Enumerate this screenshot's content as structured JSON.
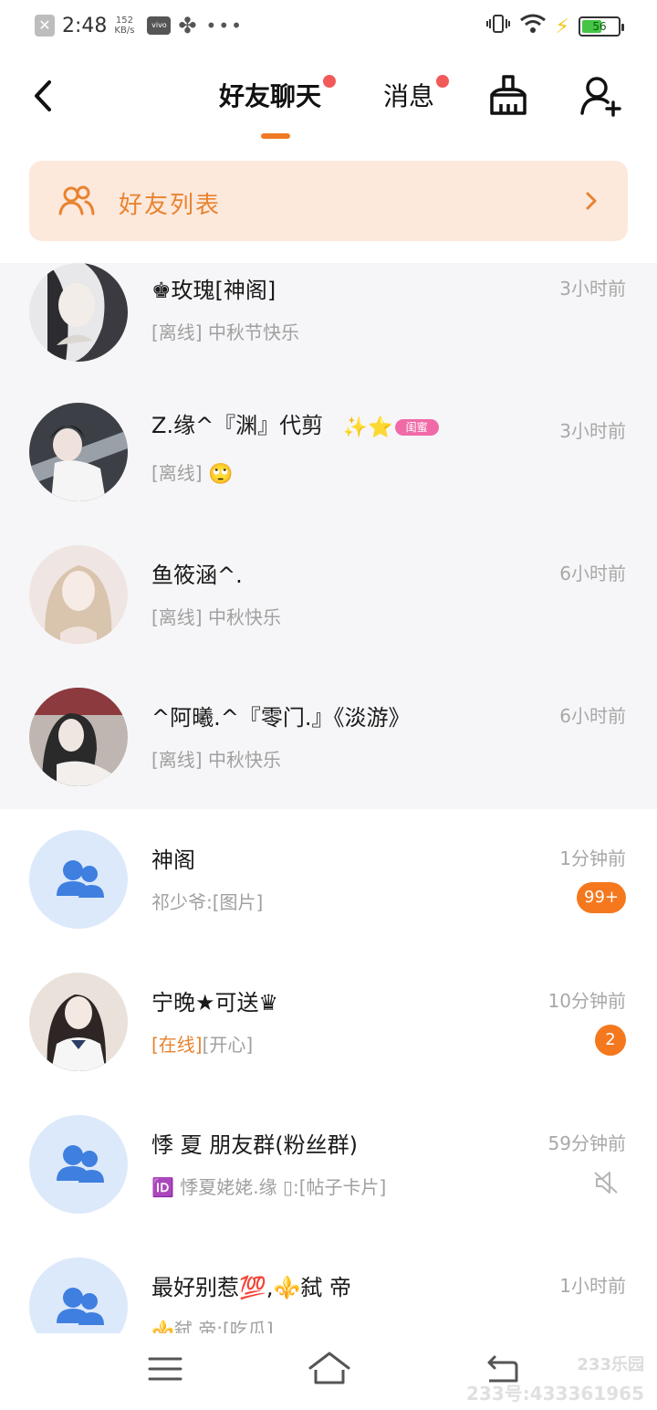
{
  "status_bar": {
    "time": "2:48",
    "speed": "152",
    "speed_unit": "KB/s",
    "carrier_logo": "vivo",
    "battery": "56",
    "battery_level": 0.56
  },
  "header": {
    "tabs": [
      {
        "label": "好友聊天",
        "active": true,
        "has_dot": true
      },
      {
        "label": "消息",
        "active": false,
        "has_dot": true
      }
    ]
  },
  "friend_list": {
    "label": "好友列表"
  },
  "chats": [
    {
      "name": "♚玫瑰[神阁]",
      "preview": "[离线] 中秋节快乐",
      "time": "3小时前",
      "pinned": true,
      "avatar": "photo"
    },
    {
      "name": "Z.缘^『渊』代剪",
      "tag": "闺蜜",
      "preview": "[离线]",
      "preview_emoji": "🙄",
      "time": "3小时前",
      "pinned": true,
      "avatar": "photo"
    },
    {
      "name": "鱼筱涵^.",
      "preview": "[离线] 中秋快乐",
      "time": "6小时前",
      "pinned": true,
      "avatar": "photo"
    },
    {
      "name": "^阿曦.^『零门.』《淡游》",
      "preview": "[离线] 中秋快乐",
      "time": "6小时前",
      "pinned": true,
      "avatar": "photo"
    },
    {
      "name": "神阁",
      "preview": "祁少爷:[图片]",
      "time": "1分钟前",
      "badge": "99+",
      "avatar": "group"
    },
    {
      "name": "宁晚★可送♛",
      "preview_status": "[在线]",
      "preview": "[开心]",
      "time": "10分钟前",
      "badge": "2",
      "avatar": "photo"
    },
    {
      "name": "悸 夏 朋友群(粉丝群)",
      "preview": "🆔 悸夏姥姥.缘 ▯:[帖子卡片]",
      "time": "59分钟前",
      "muted": true,
      "avatar": "group"
    },
    {
      "name": "最好别惹💯,⚜️弑 帝",
      "preview": "⚜️弑 帝:[吃瓜]",
      "time": "1小时前",
      "avatar": "group"
    }
  ],
  "watermark": {
    "brand": "233乐园",
    "id_text": "233号:433361965"
  },
  "colors": {
    "accent": "#f07a24",
    "banner_bg": "#fde8dc",
    "dot": "#f25a5a",
    "group_avatar_bg": "#dce9fb",
    "group_icon": "#3f7fe0"
  }
}
